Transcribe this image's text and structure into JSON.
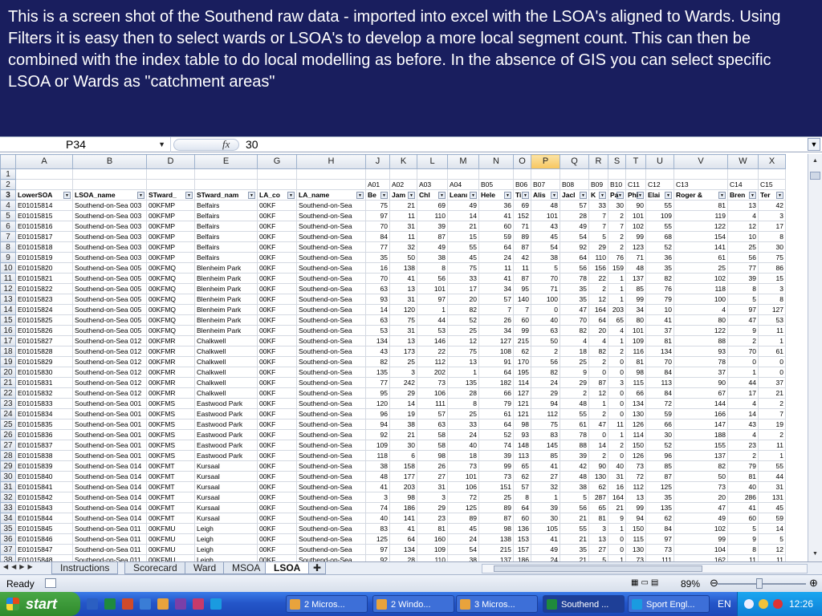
{
  "banner": {
    "text": "This is a screen shot of the Southend raw data - imported into excel with the LSOA's aligned to Wards. Using Filters it is easy then to select wards or LSOA's to develop a more local segment count. This can then be combined with the index table to do local modelling as before. In the absence of GIS you can select specific LSOA or Wards as \"catchment areas\""
  },
  "formula_bar": {
    "name_box": "P34",
    "fx_icon": "fx-icon",
    "value": "30"
  },
  "columns": [
    "A",
    "B",
    "D",
    "E",
    "G",
    "H",
    "J",
    "K",
    "L",
    "M",
    "N",
    "O",
    "P",
    "Q",
    "R",
    "S",
    "T",
    "U",
    "V",
    "W",
    "X"
  ],
  "selected_column": "P",
  "selected_row": "34",
  "row2": [
    "",
    "",
    "",
    "",
    "",
    "",
    "A01",
    "A02",
    "A03",
    "A04",
    "B05",
    "B06",
    "B07",
    "B08",
    "B09",
    "B10",
    "C11",
    "C12",
    "C13",
    "C14",
    "C15"
  ],
  "row3": [
    "LowerSOA",
    "LSOA_name",
    "STward_",
    "STward_nam",
    "LA_co",
    "LA_name",
    "Be",
    "Jam",
    "Chl",
    "Leanı",
    "Hele",
    "Ti",
    "Alis",
    "Jacl",
    "K",
    "Pa",
    "Phi",
    "Elai",
    "Roger & ",
    "Bren",
    "Ter"
  ],
  "rows": [
    [
      "4",
      "E01015814",
      "Southend-on-Sea 003",
      "00KFMP",
      "Belfairs",
      "00KF",
      "Southend-on-Sea",
      "75",
      "21",
      "69",
      "49",
      "36",
      "69",
      "48",
      "57",
      "33",
      "30",
      "90",
      "55",
      "81",
      "13",
      "42"
    ],
    [
      "5",
      "E01015815",
      "Southend-on-Sea 003",
      "00KFMP",
      "Belfairs",
      "00KF",
      "Southend-on-Sea",
      "97",
      "11",
      "110",
      "14",
      "41",
      "152",
      "101",
      "28",
      "7",
      "2",
      "101",
      "109",
      "119",
      "4",
      "3"
    ],
    [
      "6",
      "E01015816",
      "Southend-on-Sea 003",
      "00KFMP",
      "Belfairs",
      "00KF",
      "Southend-on-Sea",
      "70",
      "31",
      "39",
      "21",
      "60",
      "71",
      "43",
      "49",
      "7",
      "7",
      "102",
      "55",
      "122",
      "12",
      "17"
    ],
    [
      "7",
      "E01015817",
      "Southend-on-Sea 003",
      "00KFMP",
      "Belfairs",
      "00KF",
      "Southend-on-Sea",
      "84",
      "11",
      "87",
      "15",
      "59",
      "89",
      "45",
      "54",
      "5",
      "2",
      "99",
      "68",
      "154",
      "10",
      "8"
    ],
    [
      "8",
      "E01015818",
      "Southend-on-Sea 003",
      "00KFMP",
      "Belfairs",
      "00KF",
      "Southend-on-Sea",
      "77",
      "32",
      "49",
      "55",
      "64",
      "87",
      "54",
      "92",
      "29",
      "2",
      "123",
      "52",
      "141",
      "25",
      "30"
    ],
    [
      "9",
      "E01015819",
      "Southend-on-Sea 003",
      "00KFMP",
      "Belfairs",
      "00KF",
      "Southend-on-Sea",
      "35",
      "50",
      "38",
      "45",
      "24",
      "42",
      "38",
      "64",
      "110",
      "76",
      "71",
      "36",
      "61",
      "56",
      "75"
    ],
    [
      "10",
      "E01015820",
      "Southend-on-Sea 005",
      "00KFMQ",
      "Blenheim Park",
      "00KF",
      "Southend-on-Sea",
      "16",
      "138",
      "8",
      "75",
      "11",
      "11",
      "5",
      "56",
      "156",
      "159",
      "48",
      "35",
      "25",
      "77",
      "86"
    ],
    [
      "11",
      "E01015821",
      "Southend-on-Sea 005",
      "00KFMQ",
      "Blenheim Park",
      "00KF",
      "Southend-on-Sea",
      "70",
      "41",
      "56",
      "33",
      "41",
      "87",
      "70",
      "78",
      "22",
      "1",
      "137",
      "82",
      "102",
      "39",
      "15"
    ],
    [
      "12",
      "E01015822",
      "Southend-on-Sea 005",
      "00KFMQ",
      "Blenheim Park",
      "00KF",
      "Southend-on-Sea",
      "63",
      "13",
      "101",
      "17",
      "34",
      "95",
      "71",
      "35",
      "2",
      "1",
      "85",
      "76",
      "118",
      "8",
      "3"
    ],
    [
      "13",
      "E01015823",
      "Southend-on-Sea 005",
      "00KFMQ",
      "Blenheim Park",
      "00KF",
      "Southend-on-Sea",
      "93",
      "31",
      "97",
      "20",
      "57",
      "140",
      "100",
      "35",
      "12",
      "1",
      "99",
      "79",
      "100",
      "5",
      "8"
    ],
    [
      "14",
      "E01015824",
      "Southend-on-Sea 005",
      "00KFMQ",
      "Blenheim Park",
      "00KF",
      "Southend-on-Sea",
      "14",
      "120",
      "1",
      "82",
      "7",
      "7",
      "0",
      "47",
      "164",
      "203",
      "34",
      "10",
      "4",
      "97",
      "127"
    ],
    [
      "15",
      "E01015825",
      "Southend-on-Sea 005",
      "00KFMQ",
      "Blenheim Park",
      "00KF",
      "Southend-on-Sea",
      "63",
      "75",
      "44",
      "52",
      "26",
      "60",
      "40",
      "70",
      "64",
      "65",
      "80",
      "41",
      "80",
      "47",
      "53"
    ],
    [
      "16",
      "E01015826",
      "Southend-on-Sea 005",
      "00KFMQ",
      "Blenheim Park",
      "00KF",
      "Southend-on-Sea",
      "53",
      "31",
      "53",
      "25",
      "34",
      "99",
      "63",
      "82",
      "20",
      "4",
      "101",
      "37",
      "122",
      "9",
      "11"
    ],
    [
      "17",
      "E01015827",
      "Southend-on-Sea 012",
      "00KFMR",
      "Chalkwell",
      "00KF",
      "Southend-on-Sea",
      "134",
      "13",
      "146",
      "12",
      "127",
      "215",
      "50",
      "4",
      "4",
      "1",
      "109",
      "81",
      "88",
      "2",
      "1"
    ],
    [
      "18",
      "E01015828",
      "Southend-on-Sea 012",
      "00KFMR",
      "Chalkwell",
      "00KF",
      "Southend-on-Sea",
      "43",
      "173",
      "22",
      "75",
      "108",
      "62",
      "2",
      "18",
      "82",
      "2",
      "116",
      "134",
      "93",
      "70",
      "61"
    ],
    [
      "19",
      "E01015829",
      "Southend-on-Sea 012",
      "00KFMR",
      "Chalkwell",
      "00KF",
      "Southend-on-Sea",
      "82",
      "25",
      "112",
      "13",
      "91",
      "170",
      "56",
      "25",
      "2",
      "0",
      "81",
      "70",
      "78",
      "0",
      "0"
    ],
    [
      "20",
      "E01015830",
      "Southend-on-Sea 012",
      "00KFMR",
      "Chalkwell",
      "00KF",
      "Southend-on-Sea",
      "135",
      "3",
      "202",
      "1",
      "64",
      "195",
      "82",
      "9",
      "0",
      "0",
      "98",
      "84",
      "37",
      "1",
      "0"
    ],
    [
      "21",
      "E01015831",
      "Southend-on-Sea 012",
      "00KFMR",
      "Chalkwell",
      "00KF",
      "Southend-on-Sea",
      "77",
      "242",
      "73",
      "135",
      "182",
      "114",
      "24",
      "29",
      "87",
      "3",
      "115",
      "113",
      "90",
      "44",
      "37"
    ],
    [
      "22",
      "E01015832",
      "Southend-on-Sea 012",
      "00KFMR",
      "Chalkwell",
      "00KF",
      "Southend-on-Sea",
      "95",
      "29",
      "106",
      "28",
      "66",
      "127",
      "29",
      "2",
      "12",
      "0",
      "66",
      "84",
      "67",
      "17",
      "21"
    ],
    [
      "23",
      "E01015833",
      "Southend-on-Sea 001",
      "00KFMS",
      "Eastwood Park",
      "00KF",
      "Southend-on-Sea",
      "120",
      "14",
      "111",
      "8",
      "79",
      "121",
      "94",
      "48",
      "1",
      "0",
      "134",
      "72",
      "144",
      "4",
      "2"
    ],
    [
      "24",
      "E01015834",
      "Southend-on-Sea 001",
      "00KFMS",
      "Eastwood Park",
      "00KF",
      "Southend-on-Sea",
      "96",
      "19",
      "57",
      "25",
      "61",
      "121",
      "112",
      "55",
      "2",
      "0",
      "130",
      "59",
      "166",
      "14",
      "7"
    ],
    [
      "25",
      "E01015835",
      "Southend-on-Sea 001",
      "00KFMS",
      "Eastwood Park",
      "00KF",
      "Southend-on-Sea",
      "94",
      "38",
      "63",
      "33",
      "64",
      "98",
      "75",
      "61",
      "47",
      "11",
      "126",
      "66",
      "147",
      "43",
      "19"
    ],
    [
      "26",
      "E01015836",
      "Southend-on-Sea 001",
      "00KFMS",
      "Eastwood Park",
      "00KF",
      "Southend-on-Sea",
      "92",
      "21",
      "58",
      "24",
      "52",
      "93",
      "83",
      "78",
      "0",
      "1",
      "114",
      "30",
      "188",
      "4",
      "2"
    ],
    [
      "27",
      "E01015837",
      "Southend-on-Sea 001",
      "00KFMS",
      "Eastwood Park",
      "00KF",
      "Southend-on-Sea",
      "109",
      "30",
      "58",
      "40",
      "74",
      "148",
      "145",
      "88",
      "14",
      "2",
      "150",
      "52",
      "155",
      "23",
      "11"
    ],
    [
      "28",
      "E01015838",
      "Southend-on-Sea 001",
      "00KFMS",
      "Eastwood Park",
      "00KF",
      "Southend-on-Sea",
      "118",
      "6",
      "98",
      "18",
      "39",
      "113",
      "85",
      "39",
      "2",
      "0",
      "126",
      "96",
      "137",
      "2",
      "1"
    ],
    [
      "29",
      "E01015839",
      "Southend-on-Sea 014",
      "00KFMT",
      "Kursaal",
      "00KF",
      "Southend-on-Sea",
      "38",
      "158",
      "26",
      "73",
      "99",
      "65",
      "41",
      "42",
      "90",
      "40",
      "73",
      "85",
      "82",
      "79",
      "55"
    ],
    [
      "30",
      "E01015840",
      "Southend-on-Sea 014",
      "00KFMT",
      "Kursaal",
      "00KF",
      "Southend-on-Sea",
      "48",
      "177",
      "27",
      "101",
      "73",
      "62",
      "27",
      "48",
      "130",
      "31",
      "72",
      "87",
      "50",
      "81",
      "44"
    ],
    [
      "31",
      "E01015841",
      "Southend-on-Sea 014",
      "00KFMT",
      "Kursaal",
      "00KF",
      "Southend-on-Sea",
      "41",
      "203",
      "31",
      "106",
      "151",
      "57",
      "32",
      "38",
      "62",
      "16",
      "112",
      "125",
      "73",
      "40",
      "31"
    ],
    [
      "32",
      "E01015842",
      "Southend-on-Sea 014",
      "00KFMT",
      "Kursaal",
      "00KF",
      "Southend-on-Sea",
      "3",
      "98",
      "3",
      "72",
      "25",
      "8",
      "1",
      "5",
      "287",
      "164",
      "13",
      "35",
      "20",
      "286",
      "131"
    ],
    [
      "33",
      "E01015843",
      "Southend-on-Sea 014",
      "00KFMT",
      "Kursaal",
      "00KF",
      "Southend-on-Sea",
      "74",
      "186",
      "29",
      "125",
      "89",
      "64",
      "39",
      "56",
      "65",
      "21",
      "99",
      "135",
      "47",
      "41",
      "45"
    ],
    [
      "34",
      "E01015844",
      "Southend-on-Sea 014",
      "00KFMT",
      "Kursaal",
      "00KF",
      "Southend-on-Sea",
      "40",
      "141",
      "23",
      "89",
      "87",
      "60",
      "30",
      "21",
      "81",
      "9",
      "94",
      "62",
      "49",
      "60",
      "59"
    ],
    [
      "35",
      "E01015845",
      "Southend-on-Sea 011",
      "00KFMU",
      "Leigh",
      "00KF",
      "Southend-on-Sea",
      "83",
      "41",
      "81",
      "45",
      "98",
      "136",
      "105",
      "55",
      "3",
      "1",
      "150",
      "84",
      "102",
      "5",
      "14"
    ],
    [
      "36",
      "E01015846",
      "Southend-on-Sea 011",
      "00KFMU",
      "Leigh",
      "00KF",
      "Southend-on-Sea",
      "125",
      "64",
      "160",
      "24",
      "138",
      "153",
      "41",
      "21",
      "13",
      "0",
      "115",
      "97",
      "99",
      "9",
      "5"
    ],
    [
      "37",
      "E01015847",
      "Southend-on-Sea 011",
      "00KFMU",
      "Leigh",
      "00KF",
      "Southend-on-Sea",
      "97",
      "134",
      "109",
      "54",
      "215",
      "157",
      "49",
      "35",
      "27",
      "0",
      "130",
      "73",
      "104",
      "8",
      "12"
    ],
    [
      "38",
      "E01015848",
      "Southend-on-Sea 011",
      "00KFMU",
      "Leigh",
      "00KF",
      "Southend-on-Sea",
      "92",
      "28",
      "110",
      "38",
      "137",
      "186",
      "24",
      "21",
      "5",
      "1",
      "73",
      "111",
      "162",
      "11",
      "11"
    ]
  ],
  "sheet_tabs": {
    "instructions": "Instructions",
    "scorecard": "Scorecard",
    "ward": "Ward",
    "msoa": "MSOA",
    "lsoa": "LSOA",
    "active": "LSOA"
  },
  "status": {
    "ready": "Ready",
    "zoom": "89%"
  },
  "taskbar": {
    "start": "start",
    "tasks": [
      "2 Micros...",
      "2 Windo...",
      "3 Micros...",
      "Southend ...",
      "Sport Engl..."
    ],
    "lang": "EN",
    "clock": "12:26"
  }
}
